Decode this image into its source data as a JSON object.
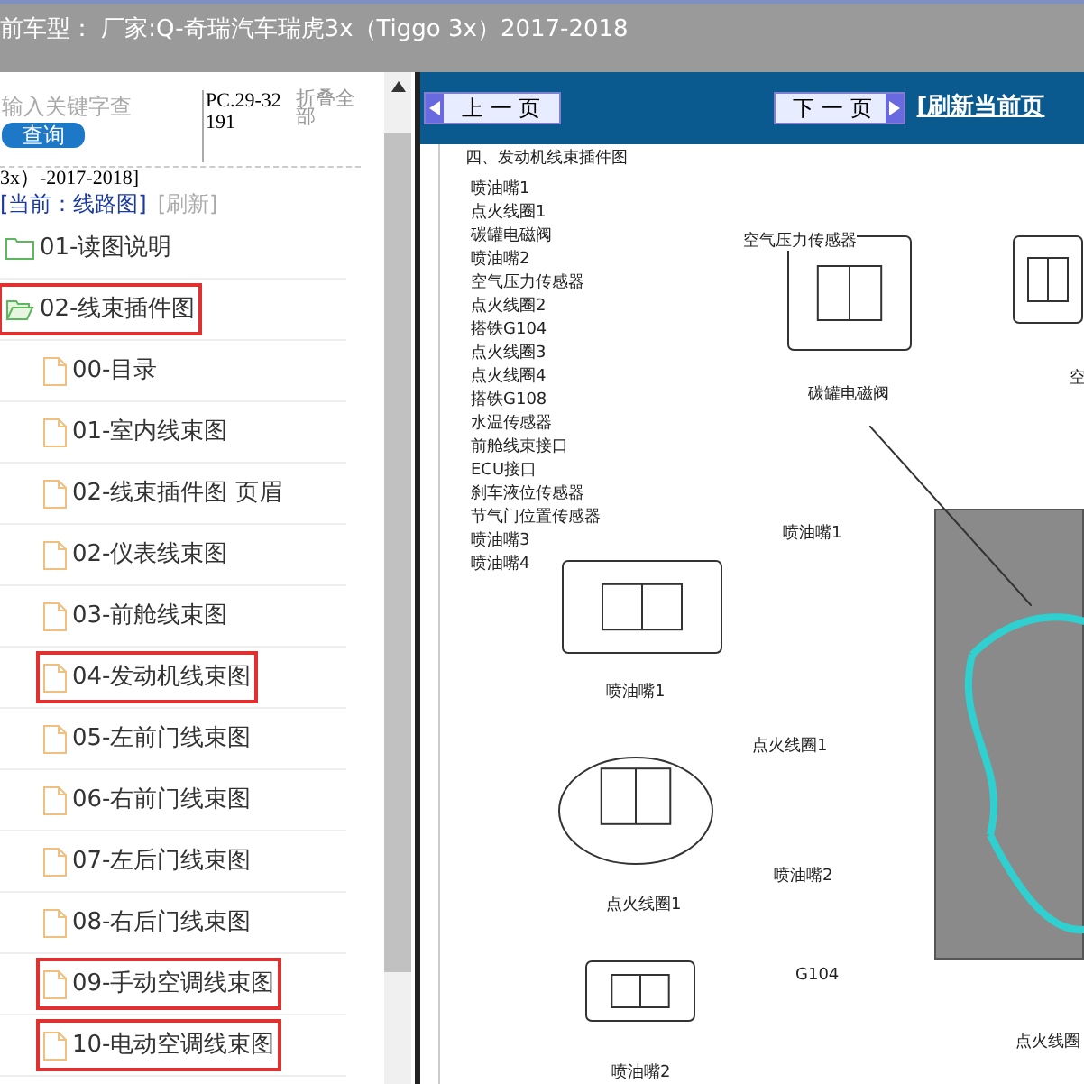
{
  "header": {
    "title": "前车型： 厂家:Q-奇瑞汽车瑞虎3x（Tiggo 3x）2017-2018"
  },
  "sidebar": {
    "search": {
      "placeholder": "输入关键字查"
    },
    "search_button": "查询",
    "code": "PC.29-32191",
    "collapse_all": "折叠全部",
    "model_tail": "3x）-2017-2018]",
    "current": "[当前：线路图]",
    "refresh": "[刷新]",
    "tree": [
      {
        "label": "01-读图说明",
        "kind": "folder",
        "expanded": false,
        "highlighted": false
      },
      {
        "label": "02-线束插件图",
        "kind": "folder",
        "expanded": true,
        "highlighted": true,
        "children": [
          {
            "label": "00-目录",
            "kind": "file",
            "highlighted": false
          },
          {
            "label": "01-室内线束图",
            "kind": "file",
            "highlighted": false
          },
          {
            "label": "02-线束插件图 页眉",
            "kind": "file",
            "highlighted": false
          },
          {
            "label": "02-仪表线束图",
            "kind": "file",
            "highlighted": false
          },
          {
            "label": "03-前舱线束图",
            "kind": "file",
            "highlighted": false
          },
          {
            "label": "04-发动机线束图",
            "kind": "file",
            "highlighted": true
          },
          {
            "label": "05-左前门线束图",
            "kind": "file",
            "highlighted": false
          },
          {
            "label": "06-右前门线束图",
            "kind": "file",
            "highlighted": false
          },
          {
            "label": "07-左后门线束图",
            "kind": "file",
            "highlighted": false
          },
          {
            "label": "08-右后门线束图",
            "kind": "file",
            "highlighted": false
          },
          {
            "label": "09-手动空调线束图",
            "kind": "file",
            "highlighted": true
          },
          {
            "label": "10-电动空调线束图",
            "kind": "file",
            "highlighted": true
          }
        ]
      }
    ]
  },
  "toolbar": {
    "prev": "上 一 页",
    "next": "下 一 页",
    "refresh_page": "[刷新当前页"
  },
  "document": {
    "title": "四、发动机线束插件图",
    "legend": [
      "喷油嘴1",
      "点火线圈1",
      "碳罐电磁阀",
      "喷油嘴2",
      "空气压力传感器",
      "点火线圈2",
      "搭铁G104",
      "点火线圈3",
      "点火线圈4",
      "搭铁G108",
      "水温传感器",
      "前舱线束接口",
      "ECU接口",
      "刹车液位传感器",
      "节气门位置传感器",
      "喷油嘴3",
      "喷油嘴4"
    ],
    "connector_labels": [
      "空气压力传感器",
      "碳罐电磁阀",
      "空",
      "喷油嘴1",
      "点火线圈1",
      "喷油嘴2"
    ],
    "callouts": [
      "喷油嘴1",
      "点火线圈1",
      "喷油嘴2",
      "G104",
      "点火线圈"
    ]
  }
}
